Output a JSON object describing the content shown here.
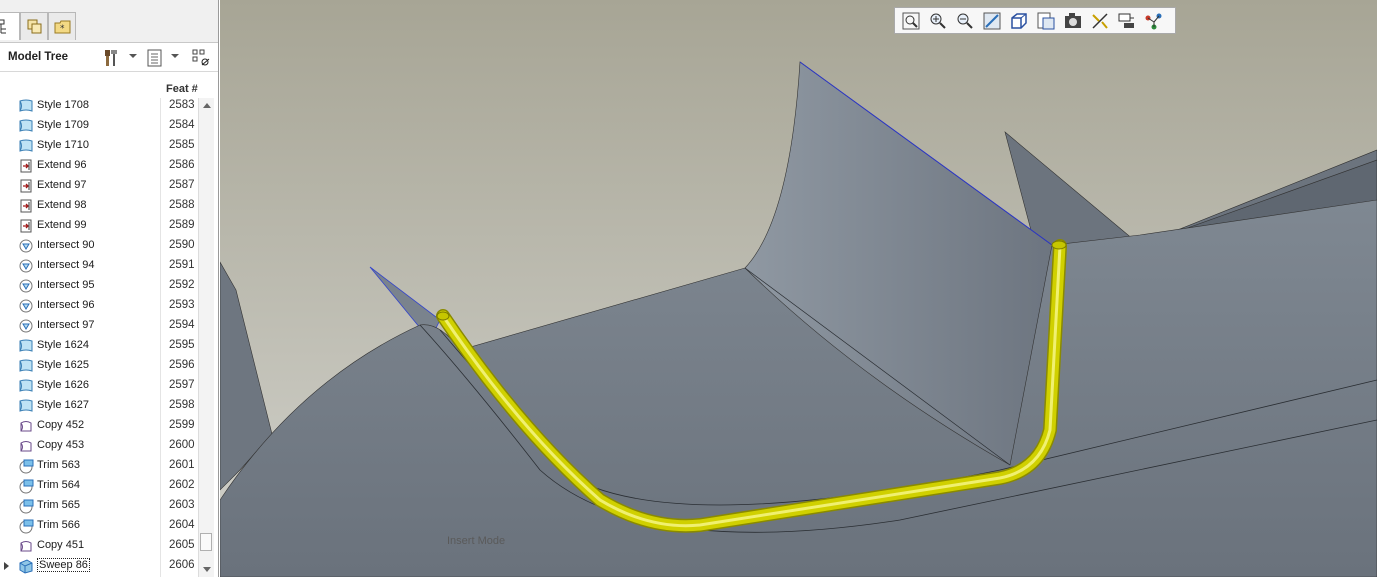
{
  "tree": {
    "title": "Model Tree",
    "column_header": "Feat #",
    "rows": [
      {
        "name": "Style 1708",
        "num": "2583",
        "icon": "style-icon"
      },
      {
        "name": "Style 1709",
        "num": "2584",
        "icon": "style-icon"
      },
      {
        "name": "Style 1710",
        "num": "2585",
        "icon": "style-icon"
      },
      {
        "name": "Extend 96",
        "num": "2586",
        "icon": "extend-icon"
      },
      {
        "name": "Extend 97",
        "num": "2587",
        "icon": "extend-icon"
      },
      {
        "name": "Extend 98",
        "num": "2588",
        "icon": "extend-icon"
      },
      {
        "name": "Extend 99",
        "num": "2589",
        "icon": "extend-icon"
      },
      {
        "name": "Intersect 90",
        "num": "2590",
        "icon": "intersect-icon"
      },
      {
        "name": "Intersect 94",
        "num": "2591",
        "icon": "intersect-icon"
      },
      {
        "name": "Intersect 95",
        "num": "2592",
        "icon": "intersect-icon"
      },
      {
        "name": "Intersect 96",
        "num": "2593",
        "icon": "intersect-icon"
      },
      {
        "name": "Intersect 97",
        "num": "2594",
        "icon": "intersect-icon"
      },
      {
        "name": "Style 1624",
        "num": "2595",
        "icon": "style-icon"
      },
      {
        "name": "Style 1625",
        "num": "2596",
        "icon": "style-icon"
      },
      {
        "name": "Style 1626",
        "num": "2597",
        "icon": "style-icon"
      },
      {
        "name": "Style 1627",
        "num": "2598",
        "icon": "style-icon"
      },
      {
        "name": "Copy 452",
        "num": "2599",
        "icon": "copy-icon"
      },
      {
        "name": "Copy 453",
        "num": "2600",
        "icon": "copy-icon"
      },
      {
        "name": "Trim 563",
        "num": "2601",
        "icon": "trim-icon"
      },
      {
        "name": "Trim 564",
        "num": "2602",
        "icon": "trim-icon"
      },
      {
        "name": "Trim 565",
        "num": "2603",
        "icon": "trim-icon"
      },
      {
        "name": "Trim 566",
        "num": "2604",
        "icon": "trim-icon"
      },
      {
        "name": "Copy 451",
        "num": "2605",
        "icon": "copy-icon"
      },
      {
        "name": "Sweep 86",
        "num": "2606",
        "icon": "sweep-icon",
        "selected": true,
        "expandable": true
      }
    ]
  },
  "tabs": [
    "model-tree-tab-icon",
    "layers-tab-icon",
    "favorites-tab-icon"
  ],
  "header_tools": [
    "tree-settings-icon",
    "show-icon",
    "tree-filter-icon"
  ],
  "view_toolbar": [
    "refit-icon",
    "zoom-in-icon",
    "zoom-out-icon",
    "repaint-icon",
    "saved-views-icon",
    "view-manager-icon",
    "capture-icon",
    "datum-display-icon",
    "annotation-display-icon",
    "spin-center-icon"
  ],
  "viewport": {
    "status": "Insert Mode",
    "sweep_color": "#d0d000",
    "surface_color": "#808993"
  }
}
